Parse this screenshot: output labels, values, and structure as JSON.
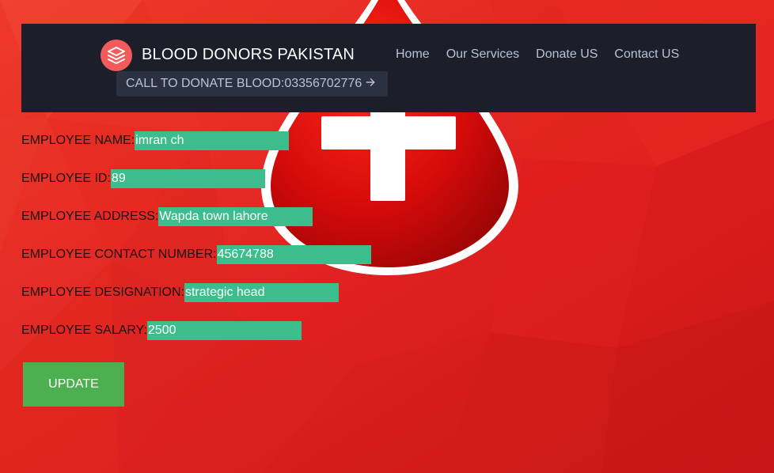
{
  "header": {
    "brand_title": "BLOOD DONORS PAKISTAN",
    "brand_icon": "layers-icon",
    "nav": [
      {
        "label": "Home"
      },
      {
        "label": "Our Services"
      },
      {
        "label": "Donate US"
      },
      {
        "label": "Contact US"
      }
    ],
    "cta_label": "CALL TO DONATE BLOOD:03356702776",
    "cta_icon": "arrow-right-icon"
  },
  "form": {
    "fields": [
      {
        "label": "EMPLOYEE NAME:",
        "value": "imran ch"
      },
      {
        "label": "EMPLOYEE ID:",
        "value": "89"
      },
      {
        "label": "EMPLOYEE ADDRESS:",
        "value": "Wapda town lahore"
      },
      {
        "label": "EMPLOYEE CONTACT NUMBER:",
        "value": "45674788"
      },
      {
        "label": "EMPLOYEE DESIGNATION:",
        "value": "strategic head"
      },
      {
        "label": "EMPLOYEE SALARY:",
        "value": "2500"
      }
    ],
    "submit_label": "UPDATE"
  },
  "colors": {
    "background": "#e52424",
    "navbar": "#1c1f2a",
    "field": "#3dbd8c",
    "button": "#4caf50",
    "logo": "#f25b5b"
  }
}
